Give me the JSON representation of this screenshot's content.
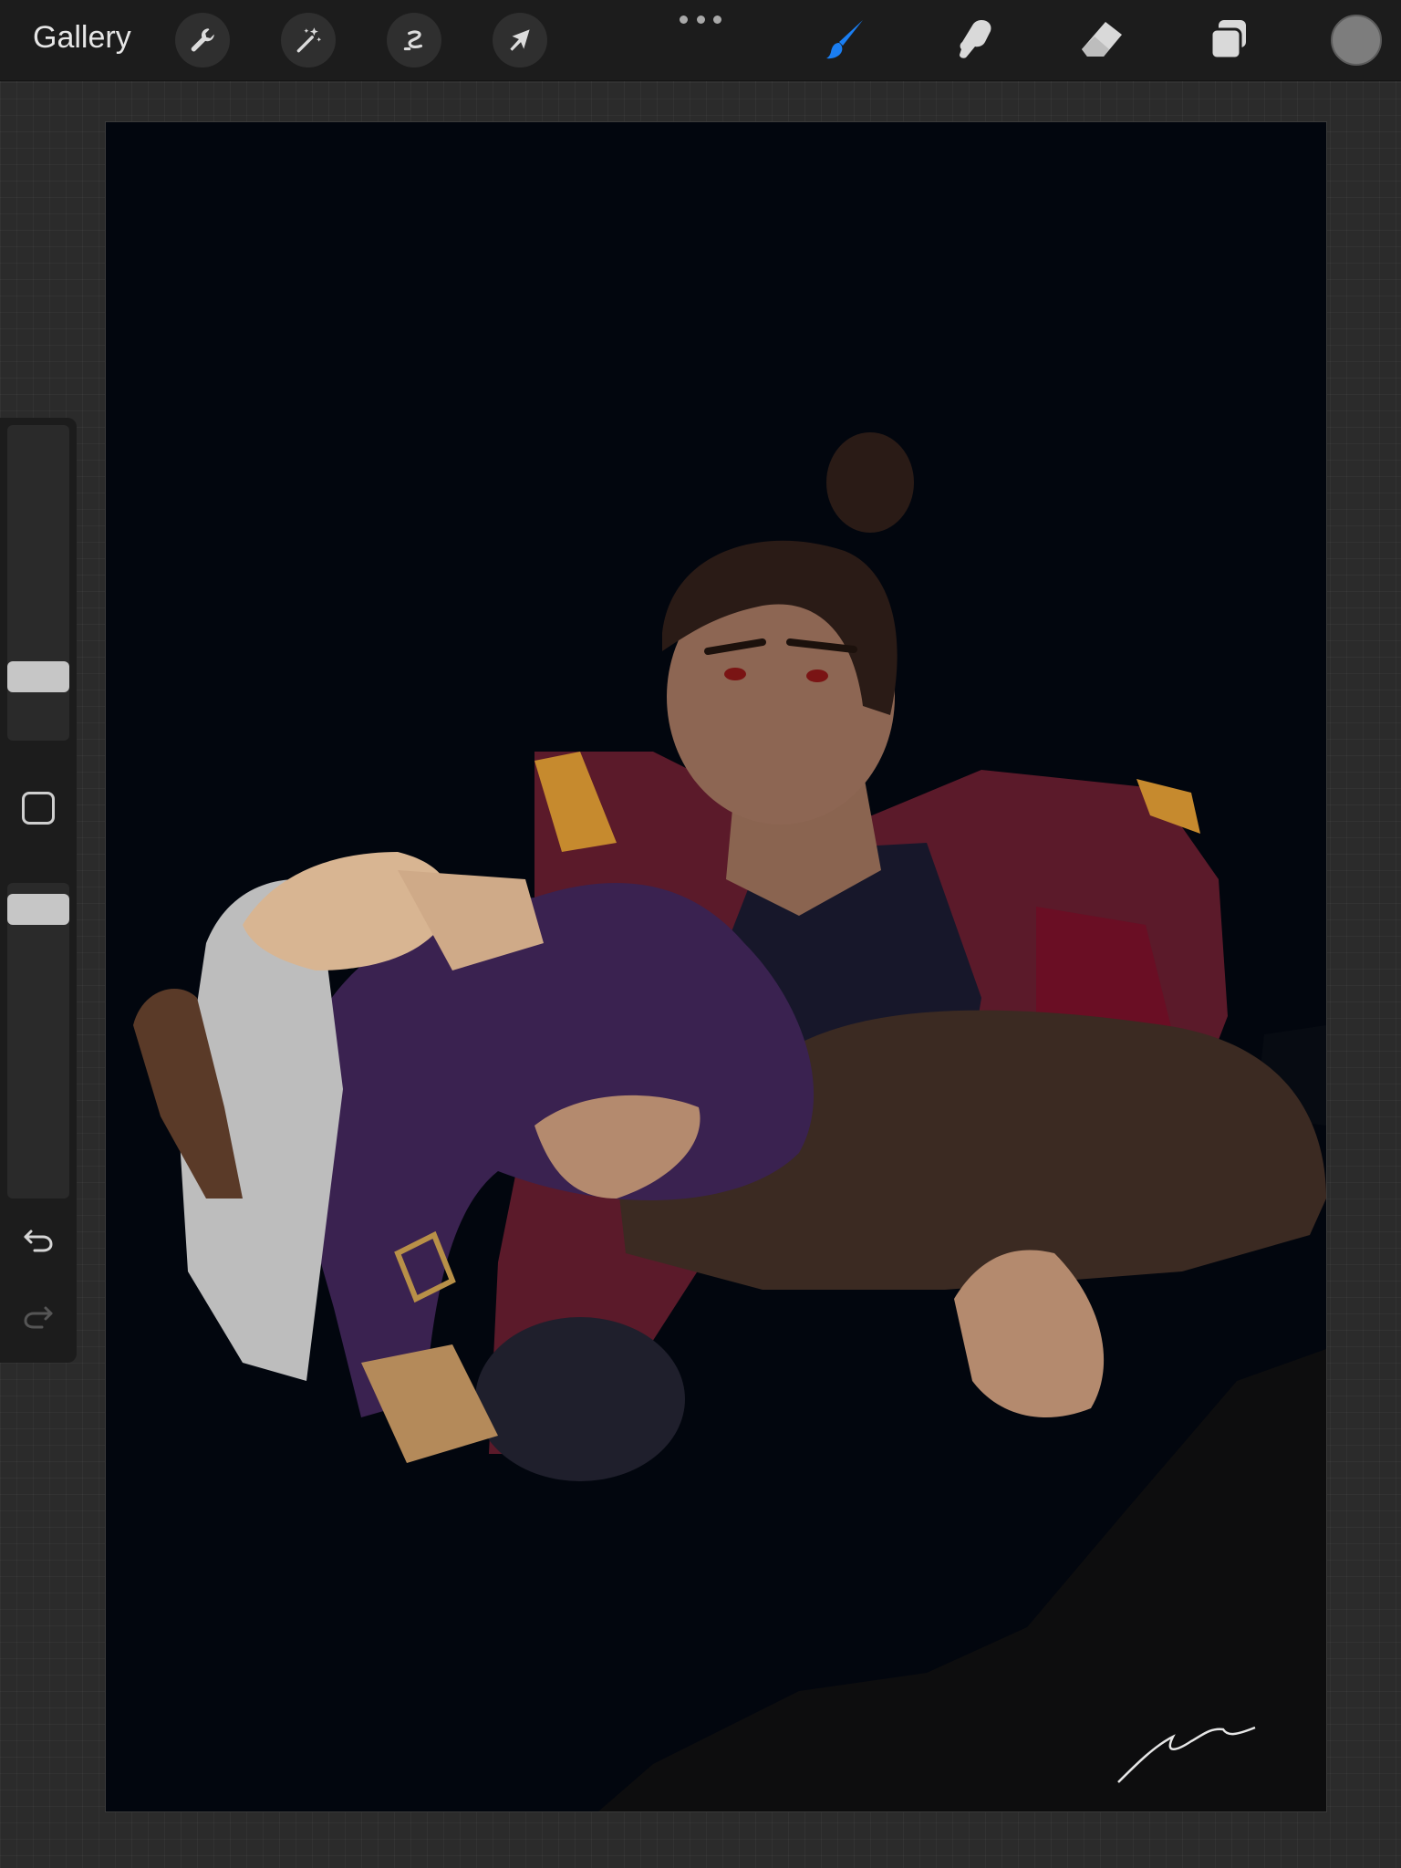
{
  "toolbar": {
    "gallery_label": "Gallery",
    "left_tools": [
      {
        "name": "actions",
        "icon": "wrench-icon"
      },
      {
        "name": "adjustments",
        "icon": "magic-wand-icon"
      },
      {
        "name": "selection",
        "icon": "selection-s-icon"
      },
      {
        "name": "transform",
        "icon": "arrow-cursor-icon"
      }
    ],
    "right_tools": [
      {
        "name": "brush",
        "icon": "paintbrush-icon",
        "active": true
      },
      {
        "name": "smudge",
        "icon": "smudge-finger-icon",
        "active": false
      },
      {
        "name": "eraser",
        "icon": "eraser-icon",
        "active": false
      },
      {
        "name": "layers",
        "icon": "layers-icon",
        "active": false
      }
    ],
    "active_color": "#7d7d7d",
    "accent_color": "#1a7ef2"
  },
  "sidebar": {
    "brush_size_level": 0.17,
    "opacity_level": 0.96,
    "modify_button_icon": "square-icon",
    "undo_icon": "undo-arrow-icon",
    "redo_icon": "redo-arrow-icon"
  },
  "canvas": {
    "background_color": "#02060e",
    "artwork_description_icon": "artwork-illustration"
  }
}
